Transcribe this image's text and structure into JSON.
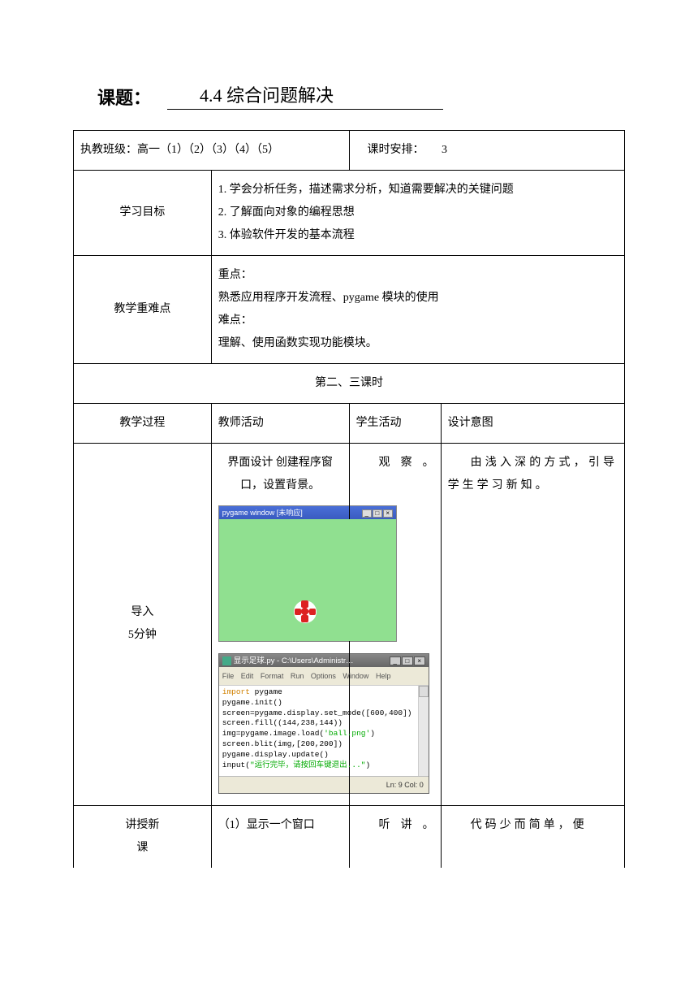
{
  "header": {
    "label": "课题：",
    "title": "4.4 综合问题解决"
  },
  "row1": {
    "class_label": "执教班级：",
    "class_value": "高一（1）（2）（3）（4）（5）",
    "period_label": "课时安排：",
    "period_value": "3"
  },
  "goals": {
    "label": "学习目标",
    "items": [
      "1. 学会分析任务，描述需求分析，知道需要解决的关键问题",
      "2. 了解面向对象的编程思想",
      "3. 体验软件开发的基本流程"
    ]
  },
  "keypoints": {
    "label": "教学重难点",
    "kp_label": "重点：",
    "kp_text": "熟悉应用程序开发流程、pygame 模块的使用",
    "diff_label": "难点：",
    "diff_text": "理解、使用函数实现功能模块。"
  },
  "session_header": "第二、三课时",
  "table_headers": {
    "col1": "教学过程",
    "col2": "教师活动",
    "col3": "学生活动",
    "col4": "设计意图"
  },
  "intro": {
    "label_line1": "导入",
    "label_line2": "5分钟",
    "teacher_title": "界面设计  创建程序窗口，设置背景。",
    "student": "观察。",
    "design": "由浅入深的方式，引导学生学习新知。"
  },
  "pygame_window": {
    "title": "pygame window  [未响应]"
  },
  "idle": {
    "title": "显示足球.py - C:\\Users\\Administr…",
    "menu": [
      "File",
      "Edit",
      "Format",
      "Run",
      "Options",
      "Window",
      "Help"
    ],
    "code": {
      "l1a": "import",
      "l1b": " pygame",
      "l2": "pygame.init()",
      "l3": "screen=pygame.display.set_mode([600,400])",
      "l4": "screen.fill((144,238,144))",
      "l5a": "img=pygame.image.load(",
      "l5b": "'ball.png'",
      "l5c": ")",
      "l6": "screen.blit(img,[200,200])",
      "l7": "pygame.display.update()",
      "l8a": "input(",
      "l8b": "\"运行完毕，请按回车键退出...\"",
      "l8c": ")"
    },
    "status": "Ln: 9 Col: 0"
  },
  "lecture": {
    "label_line1": "讲授新",
    "label_line2": "课",
    "teacher_text": "（1）显示一个窗口",
    "student": "听讲。",
    "design": "代码少而简单，便"
  }
}
